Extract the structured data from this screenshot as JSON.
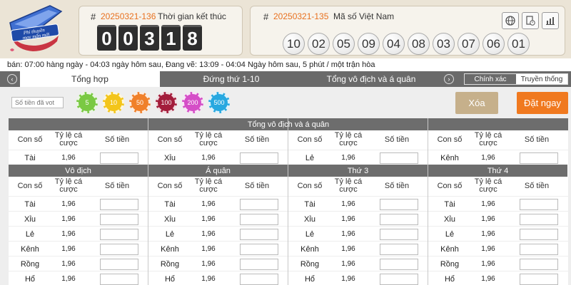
{
  "header": {
    "logo_text": [
      "Phi thuyền",
      "may mắn mới"
    ],
    "left_panel": {
      "hash": "#",
      "period": "20250321-136",
      "label": "Thời gian kết thúc",
      "digits": [
        "0",
        "0",
        "3",
        "1",
        "8"
      ]
    },
    "right_panel": {
      "hash": "#",
      "period": "20250321-135",
      "label": "Mã số Việt Nam",
      "balls": [
        "10",
        "02",
        "05",
        "09",
        "04",
        "08",
        "03",
        "07",
        "06",
        "01"
      ]
    },
    "tools": [
      "globe-icon",
      "document-clock-icon",
      "bar-chart-icon"
    ]
  },
  "info_line": "bán: 07:00 hàng ngày - 04:03 ngày hôm sau,    Đang vẽ: 13:09 - 04:04 Ngày hôm sau, 5 phút / một trận hòa",
  "tabs": {
    "items": [
      "Tổng hợp",
      "Đứng thứ 1-10",
      "Tổng vô địch và á quân"
    ],
    "active": 0,
    "toggle": [
      "Chính xác",
      "Truyền thống"
    ],
    "toggle_active": 1
  },
  "controls": {
    "amount_placeholder": "Số tiền đã vot",
    "chips": [
      {
        "value": "5",
        "color": "#7ac943"
      },
      {
        "value": "10",
        "color": "#f3c51a"
      },
      {
        "value": "50",
        "color": "#f0802a"
      },
      {
        "value": "100",
        "color": "#a31d3b"
      },
      {
        "value": "200",
        "color": "#d54ec7"
      },
      {
        "value": "500",
        "color": "#27a8e0"
      }
    ],
    "delete_label": "Xóa",
    "bet_label": "Đặt ngay"
  },
  "grid": {
    "column_headers": {
      "number": "Con số",
      "odds": [
        "Tỷ lệ cá",
        "cược"
      ],
      "amount": "Số tiền"
    },
    "top_section": {
      "title": "Tổng vô địch và á quân",
      "cells": [
        {
          "name": "Tài",
          "odds": "1,96"
        },
        {
          "name": "Xỉu",
          "odds": "1,96"
        },
        {
          "name": "Lẻ",
          "odds": "1,96"
        },
        {
          "name": "Kênh",
          "odds": "1,96"
        }
      ]
    },
    "sections": [
      {
        "title": "Vô địch",
        "rows": [
          {
            "name": "Tài",
            "odds": "1,96"
          },
          {
            "name": "Xỉu",
            "odds": "1,96"
          },
          {
            "name": "Lẻ",
            "odds": "1,96"
          },
          {
            "name": "Kênh",
            "odds": "1,96"
          },
          {
            "name": "Rồng",
            "odds": "1,96"
          },
          {
            "name": "Hổ",
            "odds": "1,96"
          }
        ]
      },
      {
        "title": "Á quân",
        "rows": [
          {
            "name": "Tài",
            "odds": "1,96"
          },
          {
            "name": "Xỉu",
            "odds": "1,96"
          },
          {
            "name": "Lẻ",
            "odds": "1,96"
          },
          {
            "name": "Kênh",
            "odds": "1,96"
          },
          {
            "name": "Rồng",
            "odds": "1,96"
          },
          {
            "name": "Hổ",
            "odds": "1,96"
          }
        ]
      },
      {
        "title": "Thứ 3",
        "rows": [
          {
            "name": "Tài",
            "odds": "1,96"
          },
          {
            "name": "Xỉu",
            "odds": "1,96"
          },
          {
            "name": "Lẻ",
            "odds": "1,96"
          },
          {
            "name": "Kênh",
            "odds": "1,96"
          },
          {
            "name": "Rồng",
            "odds": "1,96"
          },
          {
            "name": "Hổ",
            "odds": "1,96"
          }
        ]
      },
      {
        "title": "Thứ 4",
        "rows": [
          {
            "name": "Tài",
            "odds": "1,96"
          },
          {
            "name": "Xỉu",
            "odds": "1,96"
          },
          {
            "name": "Lẻ",
            "odds": "1,96"
          },
          {
            "name": "Kênh",
            "odds": "1,96"
          },
          {
            "name": "Rồng",
            "odds": "1,96"
          },
          {
            "name": "Hổ",
            "odds": "1,96"
          }
        ]
      }
    ]
  }
}
